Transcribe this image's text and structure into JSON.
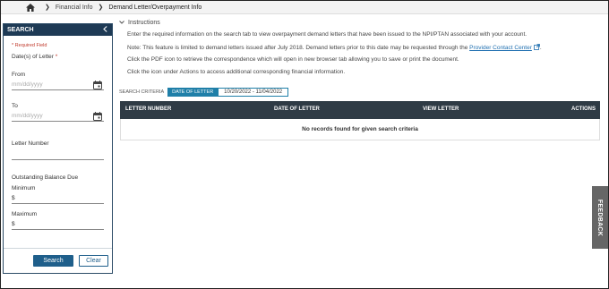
{
  "breadcrumb": {
    "items": [
      "Financial Info",
      "Demand Letter/Overpayment Info"
    ]
  },
  "sidebar": {
    "title": "SEARCH",
    "required_note": "* Required Field",
    "date_label": "Date(s) of Letter",
    "date_required_star": "*",
    "from_label": "From",
    "from_placeholder": "mm/dd/yyyy",
    "to_label": "To",
    "to_placeholder": "mm/dd/yyyy",
    "letter_number_label": "Letter Number",
    "balance_label": "Outstanding Balance Due",
    "minimum_label": "Minimum",
    "minimum_value": "$",
    "maximum_label": "Maximum",
    "maximum_value": "$",
    "search_button": "Search",
    "clear_button": "Clear"
  },
  "instructions": {
    "heading": "Instructions",
    "line1": "Enter the required information on the search tab to view overpayment demand letters that have been issued to the NPI/PTAN associated with your account.",
    "line2_prefix": "Note: This feature is limited to demand letters issued after July 2018. Demand letters prior to this date may be requested through the",
    "line2_link": "Provider Contact Center",
    "line2_suffix": ".",
    "line3": "Click the PDF icon to retrieve the correspondence which will open in new browser tab allowing you to save or print the document.",
    "line4": "Click the icon under Actions to access additional corresponding financial information."
  },
  "criteria": {
    "label": "SEARCH CRITERIA",
    "tag": "DATE OF LETTER",
    "value": "10/20/2022 - 11/04/2022"
  },
  "table": {
    "columns": [
      "LETTER NUMBER",
      "DATE OF LETTER",
      "VIEW LETTER",
      "ACTIONS"
    ],
    "empty_message": "No records found for given search criteria"
  },
  "feedback_label": "FEEDBACK",
  "colors": {
    "sidebar_header": "#1e3a55",
    "table_header": "#2f3b45",
    "accent": "#1f7fa8",
    "primary_button": "#1f5f8b",
    "required": "#c0392b",
    "feedback_tab": "#666666"
  }
}
